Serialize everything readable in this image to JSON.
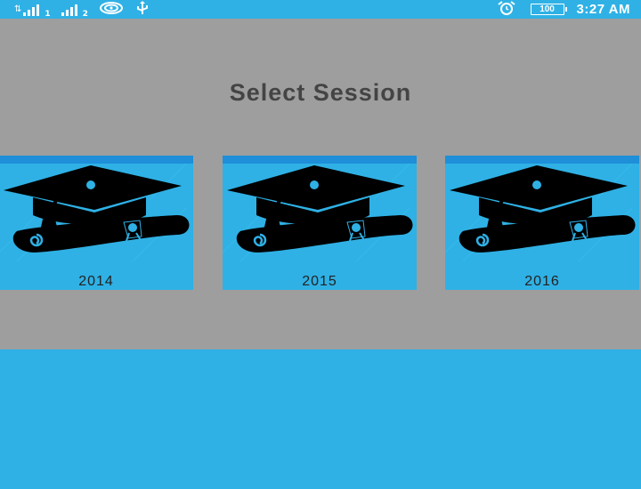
{
  "status_bar": {
    "sim1_label": "1",
    "sim2_label": "2",
    "battery_level": "100",
    "time": "3:27 AM",
    "icons": [
      "signal-icon",
      "signal-icon",
      "wifi-hotspot-icon",
      "usb-icon",
      "alarm-icon",
      "battery-icon"
    ]
  },
  "page": {
    "title": "Select Session"
  },
  "sessions": [
    {
      "year": "2014",
      "icon": "graduation-cap-diploma-icon"
    },
    {
      "year": "2015",
      "icon": "graduation-cap-diploma-icon"
    },
    {
      "year": "2016",
      "icon": "graduation-cap-diploma-icon"
    }
  ],
  "colors": {
    "accent": "#2fb1e5",
    "card_top_strip": "#1e8fd8",
    "panel_bg": "#9e9e9e",
    "title_text": "#444444"
  }
}
